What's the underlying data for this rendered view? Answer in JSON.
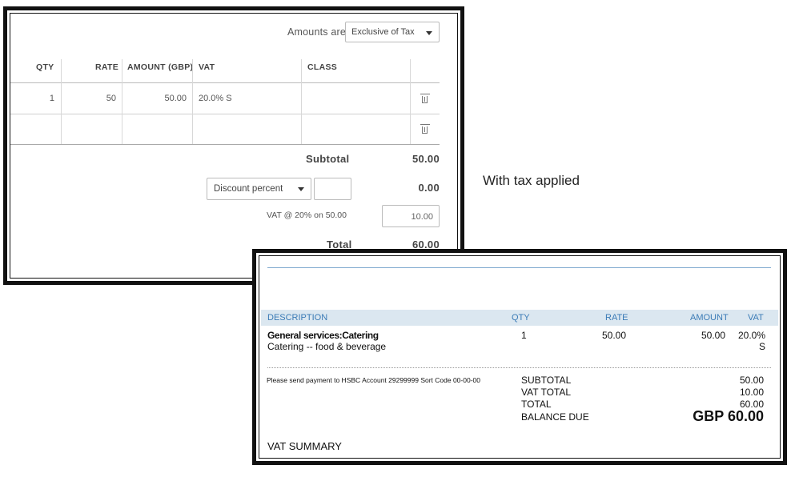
{
  "editor": {
    "amounts_label": "Amounts are",
    "amounts_select": "Exclusive of Tax",
    "columns": {
      "qty": "QTY",
      "rate": "RATE",
      "amount": "AMOUNT (GBP)",
      "vat": "VAT",
      "class": "CLASS"
    },
    "rows": [
      {
        "qty": "1",
        "rate": "50",
        "amount": "50.00",
        "vat": "20.0% S",
        "class": ""
      },
      {
        "qty": "",
        "rate": "",
        "amount": "",
        "vat": "",
        "class": ""
      }
    ],
    "subtotal_label": "Subtotal",
    "subtotal_value": "50.00",
    "discount_select": "Discount percent",
    "discount_input": "",
    "discount_value": "0.00",
    "vat_label": "VAT @ 20% on 50.00",
    "vat_value": "10.00",
    "total_label": "Total",
    "total_value": "60.00"
  },
  "caption": "With tax applied",
  "invoice": {
    "columns": {
      "description": "DESCRIPTION",
      "qty": "QTY",
      "rate": "RATE",
      "amount": "AMOUNT",
      "vat": "VAT"
    },
    "line": {
      "title": "General services:Catering",
      "subtitle": "Catering -- food & beverage",
      "qty": "1",
      "rate": "50.00",
      "amount": "50.00",
      "vat_line1": "20.0%",
      "vat_line2": "S"
    },
    "payment_note": "Please send payment to HSBC Account 29299999 Sort Code 00-00-00",
    "totals": {
      "subtotal_label": "SUBTOTAL",
      "subtotal_value": "50.00",
      "vat_total_label": "VAT TOTAL",
      "vat_total_value": "10.00",
      "total_label": "TOTAL",
      "total_value": "60.00",
      "balance_label": "BALANCE DUE",
      "balance_value": "GBP 60.00"
    },
    "vat_summary_label": "VAT SUMMARY"
  },
  "colors": {
    "frame": "#111111",
    "invoice_header_bg": "#dbe7f0",
    "invoice_header_text": "#3b7bb6"
  }
}
